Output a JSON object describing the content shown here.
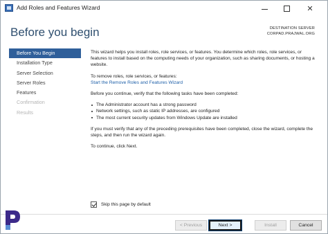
{
  "window": {
    "title": "Add Roles and Features Wizard",
    "minimize_glyph": "",
    "maximize_glyph": "",
    "close_glyph": "✕"
  },
  "header": {
    "page_title": "Before you begin",
    "destination_label": "DESTINATION SERVER",
    "destination_name": "CORPAD.PRAJWAL.ORG"
  },
  "sidebar": {
    "items": [
      {
        "label": "Before You Begin",
        "state": "active"
      },
      {
        "label": "Installation Type",
        "state": "normal"
      },
      {
        "label": "Server Selection",
        "state": "normal"
      },
      {
        "label": "Server Roles",
        "state": "normal"
      },
      {
        "label": "Features",
        "state": "normal"
      },
      {
        "label": "Confirmation",
        "state": "disabled"
      },
      {
        "label": "Results",
        "state": "disabled"
      }
    ]
  },
  "content": {
    "intro": "This wizard helps you install roles, role services, or features. You determine which roles, role services, or features to install based on the computing needs of your organization, such as sharing documents, or hosting a website.",
    "remove_heading": "To remove roles, role services, or features:",
    "remove_link": "Start the Remove Roles and Features Wizard",
    "verify_intro": "Before you continue, verify that the following tasks have been completed:",
    "bullets": [
      "The Administrator account has a strong password",
      "Network settings, such as static IP addresses, are configured",
      "The most current security updates from Windows Update are installed"
    ],
    "prereq_note": "If you must verify that any of the preceding prerequisites have been completed, close the wizard, complete the steps, and then run the wizard again.",
    "continue_note": "To continue, click Next."
  },
  "skip": {
    "label": "Skip this page by default",
    "checked": true
  },
  "buttons": {
    "previous": "< Previous",
    "next": "Next >",
    "install": "Install",
    "cancel": "Cancel"
  },
  "colors": {
    "accent": "#2f5f9a",
    "title": "#2f4f6f",
    "link": "#1d5fa8",
    "logo": "#3c2a8a"
  },
  "logo": {
    "name": "prajwal-logo-icon"
  }
}
